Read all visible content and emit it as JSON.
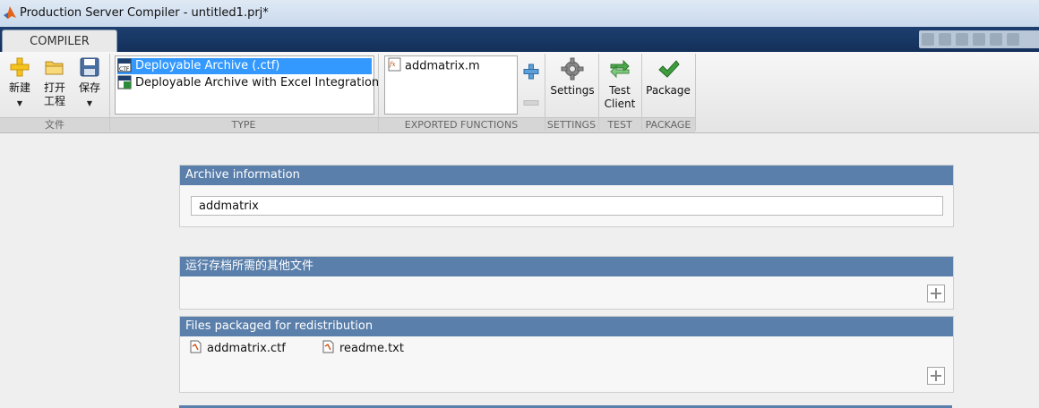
{
  "window": {
    "title": "Production Server Compiler - untitled1.prj*"
  },
  "tabs": [
    {
      "label": "COMPILER"
    }
  ],
  "ribbon": {
    "file_group": {
      "label": "文件",
      "new_label": "新建",
      "open_label_1": "打开",
      "open_label_2": "工程",
      "save_label": "保存"
    },
    "type_group": {
      "label": "TYPE",
      "items": [
        {
          "label": "Deployable Archive (.ctf)",
          "selected": true
        },
        {
          "label": "Deployable Archive with Excel Integration",
          "selected": false
        }
      ]
    },
    "functions_group": {
      "label": "EXPORTED FUNCTIONS",
      "items": [
        {
          "label": "addmatrix.m"
        }
      ]
    },
    "settings_group": {
      "label": "SETTINGS",
      "button_label": "Settings"
    },
    "test_group": {
      "label": "TEST",
      "button_label_1": "Test",
      "button_label_2": "Client"
    },
    "package_group": {
      "label": "PACKAGE",
      "button_label": "Package"
    }
  },
  "panels": {
    "archive_info": {
      "title": "Archive information",
      "name_value": "addmatrix"
    },
    "additional_files": {
      "title": "运行存档所需的其他文件"
    },
    "redistribution": {
      "title": "Files packaged for redistribution",
      "files": [
        {
          "name": "addmatrix.ctf"
        },
        {
          "name": "readme.txt"
        }
      ]
    }
  },
  "colors": {
    "panel_header": "#5a7fab",
    "selection": "#3399ff",
    "tabstrip": "#1d3f6f"
  }
}
